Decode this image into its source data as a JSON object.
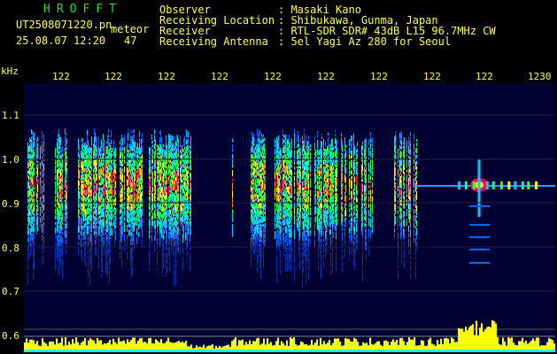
{
  "header": {
    "app_title": "HROFFT",
    "file_name": "UT2508071220.pn",
    "meteor_label": "meteor",
    "datetime": "25.08.07 12:20",
    "meteor_count": "47",
    "info": [
      {
        "label": "Observer",
        "value": ": Masaki Kano"
      },
      {
        "label": "Receiving Location",
        "value": ": Shibukawa, Gunma, Japan"
      },
      {
        "label": "Receiver",
        "value": ": RTL-SDR SDR# 43dB L15 96.7MHz CW"
      },
      {
        "label": "Receiving Antenna",
        "value": ": 5el Yagi Az 280 for Seoul"
      }
    ]
  },
  "axis": {
    "y_unit": "kHz",
    "y_ticks": [
      "1.1",
      "1.0",
      "0.9",
      "0.8",
      "0.7",
      "0.6"
    ],
    "x_ticks": [
      "122",
      "122",
      "122",
      "122",
      "122",
      "122",
      "122",
      "122",
      "122",
      "1230"
    ]
  },
  "colors": {
    "app_title": "#22dd33",
    "header_text": "#ffff40",
    "spectrum_bg": "#000033",
    "signal_bar": "#ffff00",
    "signal_base": "#00ffff"
  }
}
